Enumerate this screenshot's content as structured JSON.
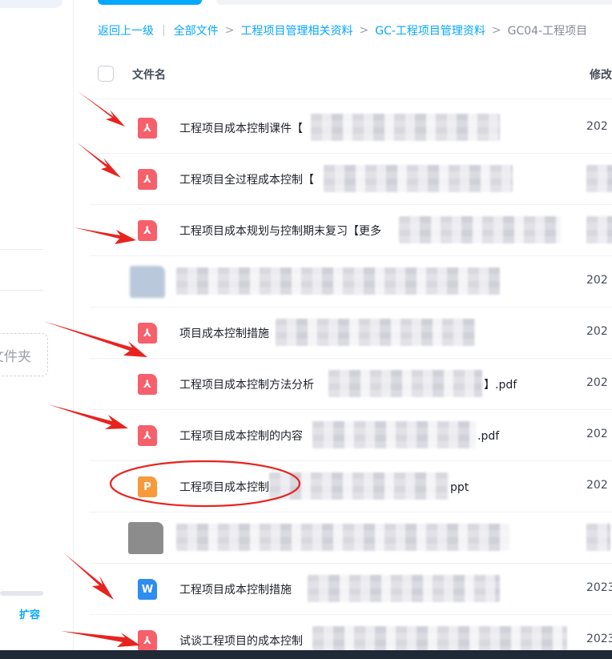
{
  "breadcrumb": {
    "back": "返回上一级",
    "separator": "|",
    "arrow": ">",
    "crumbs": [
      "全部文件",
      "工程项目管理相关资料",
      "GC-工程项目管理资料"
    ],
    "current": "GC04-工程项目"
  },
  "sidebar": {
    "new_folder_label": "文件夹",
    "expand_label": "扩容"
  },
  "list_header": {
    "name": "文件名",
    "modified": "修改"
  },
  "files": [
    {
      "type": "pdf",
      "icon_glyph": "⅄",
      "name": "工程项目成本控制课件【",
      "ext": "",
      "date": "202"
    },
    {
      "type": "pdf",
      "icon_glyph": "⅄",
      "name": "工程项目全过程成本控制【",
      "ext": "",
      "date": ""
    },
    {
      "type": "pdf",
      "icon_glyph": "⅄",
      "name": "工程项目成本规划与控制期末复习【更多",
      "ext": "",
      "date": ""
    },
    {
      "type": "blur",
      "icon_glyph": "",
      "name": "",
      "ext": "",
      "date": "202"
    },
    {
      "type": "pdf",
      "icon_glyph": "⅄",
      "name": "项目成本控制措施",
      "ext": "",
      "date": "202"
    },
    {
      "type": "pdf",
      "icon_glyph": "⅄",
      "name": "工程项目成本控制方法分析",
      "ext": "】.pdf",
      "date": "202"
    },
    {
      "type": "pdf",
      "icon_glyph": "⅄",
      "name": "工程项目成本控制的内容",
      "ext": ".pdf",
      "date": "202"
    },
    {
      "type": "ppt",
      "icon_glyph": "P",
      "name": "工程项目成本控制",
      "ext": "ppt",
      "date": "202"
    },
    {
      "type": "blurgray",
      "icon_glyph": "",
      "name": "",
      "ext": "",
      "date": ""
    },
    {
      "type": "doc",
      "icon_glyph": "W",
      "name": "工程项目成本控制措施",
      "ext": "",
      "date": "2023"
    },
    {
      "type": "pdf",
      "icon_glyph": "⅄",
      "name": "试谈工程项目的成本控制",
      "ext": "",
      "date": "2023"
    }
  ],
  "colors": {
    "accent": "#06a7ff",
    "pdf": "#f5606b",
    "ppt": "#f79a3a",
    "doc": "#2f8cf0",
    "annotation": "#e8231f"
  }
}
